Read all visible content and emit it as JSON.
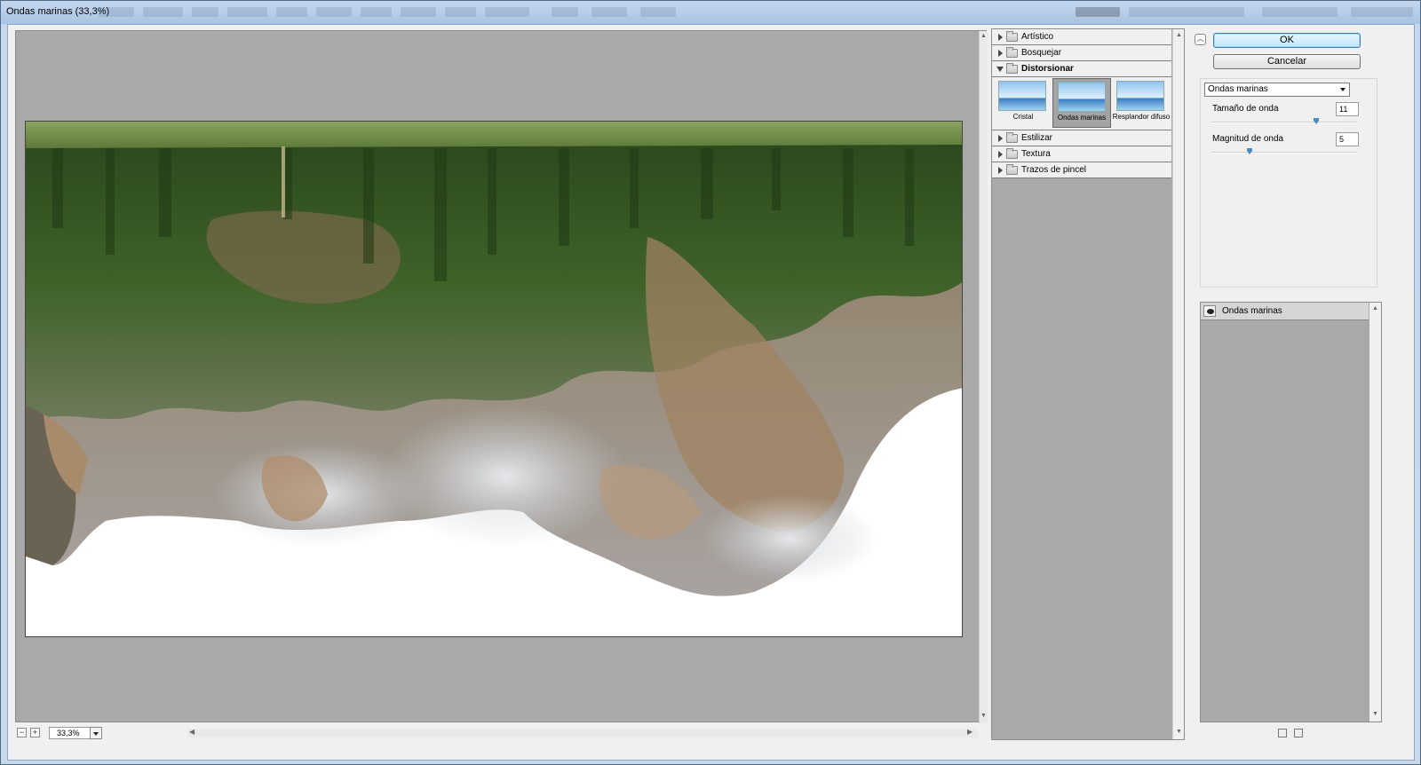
{
  "window": {
    "title": "Ondas marinas (33,3%)"
  },
  "preview": {
    "zoom": "33,3%"
  },
  "filter_gallery": {
    "categories": [
      {
        "label": "Artístico"
      },
      {
        "label": "Bosquejar"
      },
      {
        "label": "Distorsionar"
      },
      {
        "label": "Estilizar"
      },
      {
        "label": "Textura"
      },
      {
        "label": "Trazos de pincel"
      }
    ],
    "thumbnails": [
      {
        "label": "Cristal"
      },
      {
        "label": "Ondas marinas"
      },
      {
        "label": "Resplandor difuso"
      }
    ]
  },
  "buttons": {
    "ok": "OK",
    "cancel": "Cancelar"
  },
  "settings": {
    "filter_select": "Ondas marinas",
    "params": [
      {
        "label": "Tamaño de onda",
        "value": "11"
      },
      {
        "label": "Magnitud de onda",
        "value": "5"
      }
    ]
  },
  "layers": {
    "items": [
      {
        "label": "Ondas marinas"
      }
    ]
  },
  "colors": {
    "accent": "#3c7fb1",
    "panel_bg": "#a9a9a9"
  }
}
